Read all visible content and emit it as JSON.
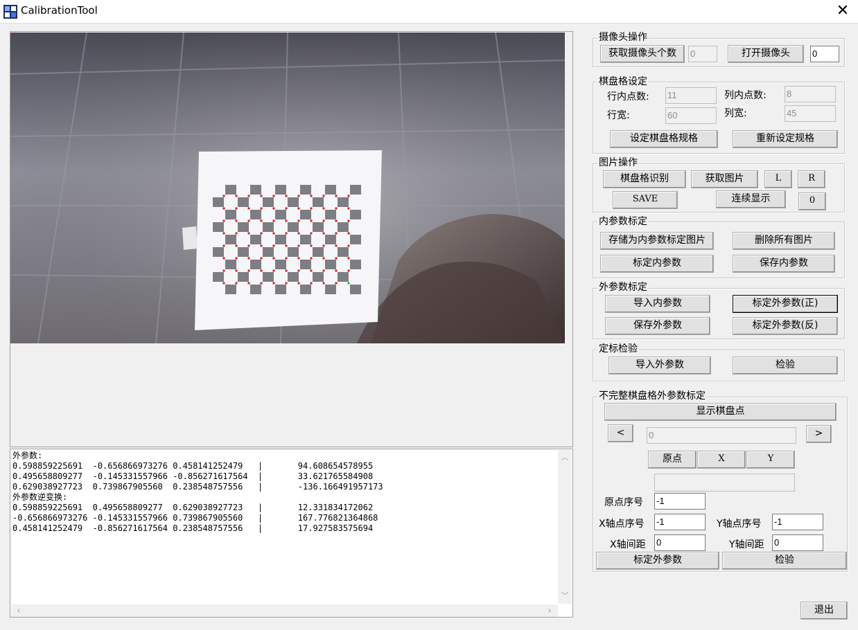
{
  "window": {
    "title": "CalibrationTool",
    "close_glyph": "✕"
  },
  "output": {
    "lines": [
      "外参数:",
      "0.598859225691  -0.656866973276 0.458141252479   |       94.608654578955",
      "0.495658809277  -0.145331557966 -0.856271617564  |       33.621765584908",
      "0.629038927723  0.739867905560  0.238548757556   |       -136.166491957173",
      "外参数逆变换:",
      "0.598859225691  0.495658809277  0.629038927723   |       12.331834172062",
      "-0.656866973276 -0.145331557966 0.739867905560   |       167.776821364868",
      "0.458141252479  -0.856271617564 0.238548757556   |       17.927583575694"
    ]
  },
  "camera_op": {
    "title": "摄像头操作",
    "get_count_label": "获取摄像头个数",
    "count_value": "0",
    "open_label": "打开摄像头",
    "camera_index": "0"
  },
  "chessboard": {
    "title": "棋盘格设定",
    "row_points_label": "行内点数:",
    "row_points_value": "11",
    "col_points_label": "列内点数:",
    "col_points_value": "8",
    "row_width_label": "行宽:",
    "row_width_value": "60",
    "col_width_label": "列宽:",
    "col_width_value": "45",
    "set_label": "设定棋盘格规格",
    "reset_label": "重新设定规格"
  },
  "image_op": {
    "title": "图片操作",
    "detect_label": "棋盘格识别",
    "get_image_label": "获取图片",
    "l_label": "L",
    "r_label": "R",
    "save_label": "SAVE",
    "continuous_label": "连续显示",
    "counter_label": "0"
  },
  "intrinsic": {
    "title": "内参数标定",
    "store_label": "存储为内参数标定图片",
    "delete_label": "删除所有图片",
    "calibrate_label": "标定内参数",
    "save_label": "保存内参数"
  },
  "extrinsic": {
    "title": "外参数标定",
    "import_label": "导入内参数",
    "calib_pos_label": "标定外参数(正)",
    "save_label": "保存外参数",
    "calib_neg_label": "标定外参数(反)"
  },
  "verify": {
    "title": "定标检验",
    "import_label": "导入外参数",
    "check_label": "检验"
  },
  "incomplete": {
    "title": "不完整棋盘格外参数标定",
    "show_points_label": "显示棋盘点",
    "prev_label": "<",
    "index_value": "0",
    "next_label": ">",
    "origin_btn_label": "原点",
    "x_btn_label": "X",
    "y_btn_label": "Y",
    "info_value": "",
    "origin_index_label": "原点序号",
    "origin_index_value": "-1",
    "x_index_label": "X轴点序号",
    "x_index_value": "-1",
    "y_index_label": "Y轴点序号",
    "y_index_value": "-1",
    "x_spacing_label": "X轴间距",
    "x_spacing_value": "0",
    "y_spacing_label": "Y轴间距",
    "y_spacing_value": "0",
    "calibrate_label": "标定外参数",
    "check_label": "检验"
  },
  "exit_label": "退出",
  "colors": {
    "corner_dot": "#e01818",
    "last_corner_dot": "#20c020",
    "window_bg": "#f0f0f0"
  }
}
